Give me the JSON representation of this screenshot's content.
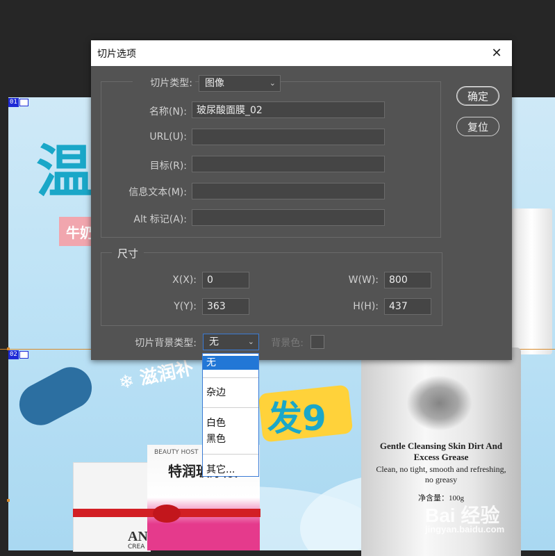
{
  "dialog": {
    "title": "切片选项",
    "close_icon": "close-icon",
    "slice_type_label": "切片类型:",
    "slice_type_value": "图像",
    "fields": [
      {
        "label": "名称(N):",
        "value": "玻尿酸面膜_02"
      },
      {
        "label": "URL(U):",
        "value": ""
      },
      {
        "label": "目标(R):",
        "value": ""
      },
      {
        "label": "信息文本(M):",
        "value": ""
      },
      {
        "label": "Alt 标记(A):",
        "value": ""
      }
    ],
    "size_group": {
      "title": "尺寸",
      "x_label": "X(X):",
      "x_value": "0",
      "y_label": "Y(Y):",
      "y_value": "363",
      "w_label": "W(W):",
      "w_value": "800",
      "h_label": "H(H):",
      "h_value": "437"
    },
    "bg_type_label": "切片背景类型:",
    "bg_type_value": "无",
    "bg_color_label": "背景色:",
    "ok_label": "确定",
    "reset_label": "复位"
  },
  "dropdown": {
    "options": [
      "无",
      "杂边",
      "白色",
      "黑色",
      "其它..."
    ],
    "selected": "无"
  },
  "slices": [
    {
      "number": "01"
    },
    {
      "number": "02"
    }
  ],
  "canvas": {
    "headline_char": "温",
    "badge_text": "牛奶",
    "slogan": "❄ 滋润补",
    "promo": "发9",
    "tube_title": "Gentle Cleansing Skin Dirt And Excess Grease",
    "tube_subtitle": "Clean, no tight, smooth and refreshing, no greasy",
    "tube_net": "净含量：100g",
    "pack_title": "特润玻尿酸",
    "pack_brand": "BEAUTY HOST",
    "white_pack_text": "AN",
    "white_pack_sub": "CREA",
    "watermark_main": "Bai 经验",
    "watermark_url": "jingyan.baidu.com"
  }
}
